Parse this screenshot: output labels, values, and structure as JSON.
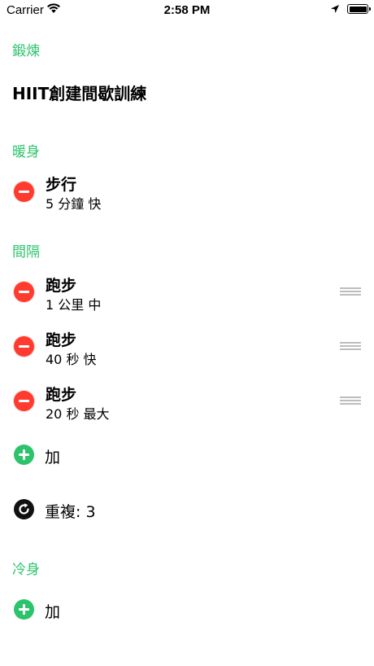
{
  "status_bar": {
    "carrier": "Carrier",
    "time": "2:58 PM"
  },
  "header": {
    "section_label": "鍛煉",
    "title": "HIIT創建間歇訓練"
  },
  "warmup": {
    "section_label": "暖身",
    "items": [
      {
        "name": "步行",
        "detail": "5 分鐘  快"
      }
    ]
  },
  "intervals": {
    "section_label": "間隔",
    "items": [
      {
        "name": "跑步",
        "detail": "1 公里  中"
      },
      {
        "name": "跑步",
        "detail": "40 秒  快"
      },
      {
        "name": "跑步",
        "detail": "20 秒  最大"
      }
    ],
    "add_label": "加",
    "repeat_label": "重複:  3"
  },
  "cooldown": {
    "section_label": "冷身",
    "add_label": "加"
  },
  "colors": {
    "accent_green": "#2cc36b",
    "delete_red": "#ff3b30"
  }
}
